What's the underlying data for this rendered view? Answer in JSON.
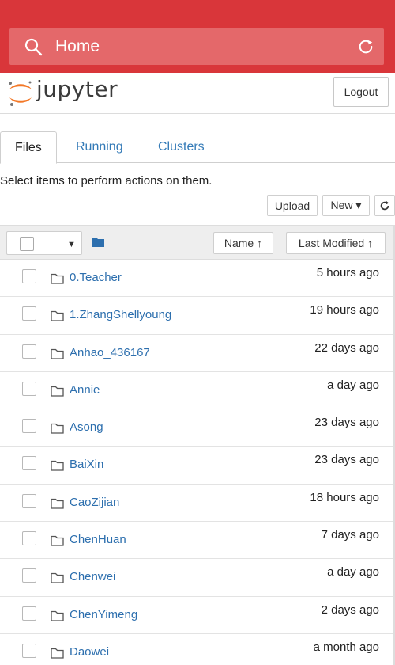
{
  "browser": {
    "address_text": "Home",
    "colors": {
      "bar": "#d9363a",
      "address_bg": "#e4686a"
    }
  },
  "header": {
    "logo_text": "jupyter",
    "logout_label": "Logout"
  },
  "tabs": [
    {
      "label": "Files",
      "active": true
    },
    {
      "label": "Running",
      "active": false
    },
    {
      "label": "Clusters",
      "active": false
    }
  ],
  "helper_text": "Select items to perform actions on them.",
  "toolbar": {
    "upload_label": "Upload",
    "new_label": "New ▾",
    "refresh_icon": "refresh-icon"
  },
  "list_header": {
    "name_label": "Name ↑",
    "last_modified_label": "Last Modified ↑"
  },
  "rows": [
    {
      "name": "0.Teacher",
      "modified": "5 hours ago"
    },
    {
      "name": "1.ZhangShellyoung",
      "modified": "19 hours ago"
    },
    {
      "name": "Anhao_436167",
      "modified": "22 days ago"
    },
    {
      "name": "Annie",
      "modified": "a day ago"
    },
    {
      "name": "Asong",
      "modified": "23 days ago"
    },
    {
      "name": "BaiXin",
      "modified": "23 days ago"
    },
    {
      "name": "CaoZijian",
      "modified": "18 hours ago"
    },
    {
      "name": "ChenHuan",
      "modified": "7 days ago"
    },
    {
      "name": "Chenwei",
      "modified": "a day ago"
    },
    {
      "name": "ChenYimeng",
      "modified": "2 days ago"
    },
    {
      "name": "Daowei",
      "modified": "a month ago"
    }
  ]
}
